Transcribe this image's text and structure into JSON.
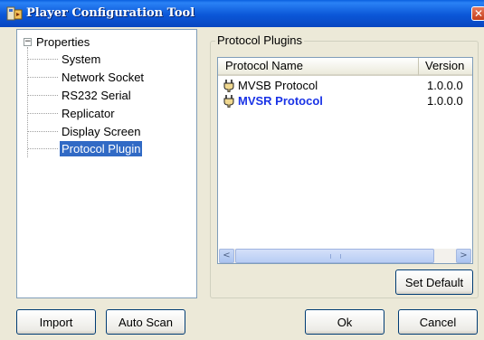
{
  "window": {
    "title": "Player Configuration Tool",
    "close_glyph": "✕"
  },
  "tree": {
    "toggle": "−",
    "root_label": "Properties",
    "items": [
      {
        "label": "System",
        "selected": false
      },
      {
        "label": "Network Socket",
        "selected": false
      },
      {
        "label": "RS232 Serial",
        "selected": false
      },
      {
        "label": "Replicator",
        "selected": false
      },
      {
        "label": "Display Screen",
        "selected": false
      },
      {
        "label": "Protocol Plugin",
        "selected": true
      }
    ]
  },
  "plugins": {
    "group_title": "Protocol Plugins",
    "columns": {
      "name": "Protocol Name",
      "version": "Version"
    },
    "rows": [
      {
        "name": "MVSB Protocol",
        "version": "1.0.0.0",
        "icon": "plug-icon",
        "selected": false
      },
      {
        "name": "MVSR Protocol",
        "version": "1.0.0.0",
        "icon": "plug-icon",
        "selected": true
      }
    ],
    "scroll": {
      "left_glyph": "<",
      "right_glyph": ">"
    },
    "set_default_label": "Set Default"
  },
  "footer": {
    "import_label": "Import",
    "auto_scan_label": "Auto Scan",
    "ok_label": "Ok",
    "cancel_label": "Cancel"
  },
  "colors": {
    "title_bar": "#0b57d8",
    "selection": "#316ac5",
    "selected_row_text": "#1a33e6",
    "close_button": "#c43d1a"
  }
}
